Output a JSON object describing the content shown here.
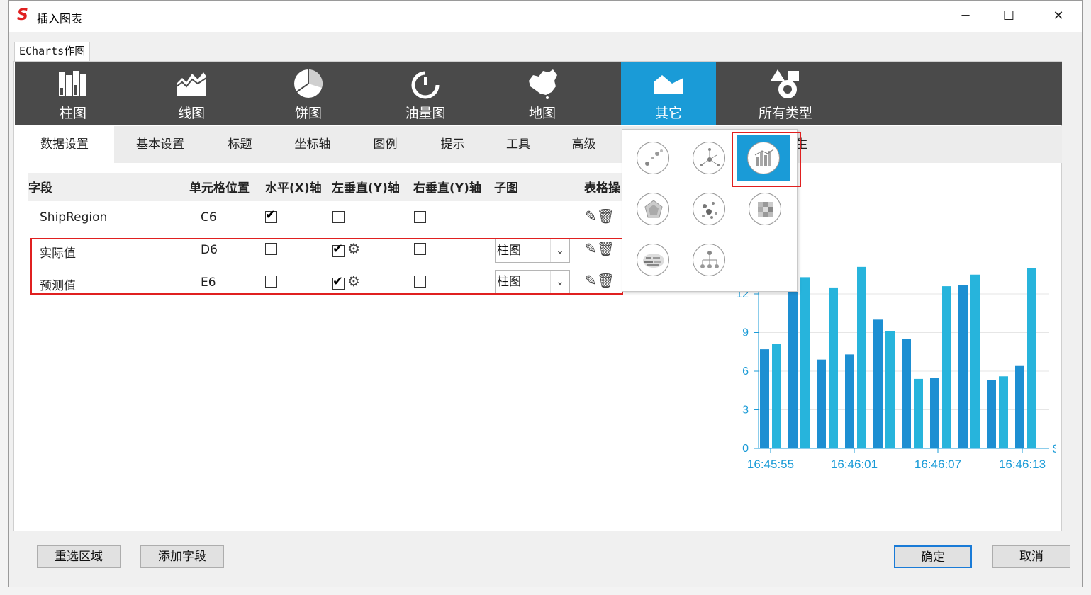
{
  "window": {
    "title": "插入图表",
    "minimize": "─",
    "maximize": "☐",
    "close": "✕",
    "logo": "S"
  },
  "editor_tab": "ECharts作图",
  "chart_types": [
    {
      "label": "柱图",
      "icon": "bar-chart-icon"
    },
    {
      "label": "线图",
      "icon": "line-chart-icon"
    },
    {
      "label": "饼图",
      "icon": "pie-chart-icon"
    },
    {
      "label": "油量图",
      "icon": "gauge-icon"
    },
    {
      "label": "地图",
      "icon": "map-icon"
    },
    {
      "label": "其它",
      "icon": "other-chart-icon",
      "active": true
    },
    {
      "label": "所有类型",
      "icon": "all-types-icon"
    }
  ],
  "sub_tabs": [
    "数据设置",
    "基本设置",
    "标题",
    "坐标轴",
    "图例",
    "提示",
    "工具",
    "高级",
    "生"
  ],
  "table": {
    "headers": [
      "字段",
      "单元格位置",
      "水平(X)轴",
      "左垂直(Y)轴",
      "右垂直(Y)轴",
      "子图",
      "表格操"
    ],
    "rows": [
      {
        "field": "ShipRegion",
        "cell": "C6",
        "x_axis": true,
        "y_left": false,
        "y_right": false,
        "subchart": ""
      },
      {
        "field": "实际值",
        "cell": "D6",
        "x_axis": false,
        "y_left": true,
        "y_right": false,
        "subchart": "柱图"
      },
      {
        "field": "预测值",
        "cell": "E6",
        "x_axis": false,
        "y_left": true,
        "y_right": false,
        "subchart": "柱图"
      }
    ]
  },
  "popup_icons": [
    "scatter-icon",
    "radial-tree-icon",
    "mixed-bar-line-icon",
    "radar-icon",
    "graph-icon",
    "heatmap-icon",
    "word-cloud-icon",
    "tree-icon"
  ],
  "chart_data": {
    "type": "bar",
    "x_tick_labels": [
      "16:45:55",
      "16:46:01",
      "16:46:07",
      "16:46:13"
    ],
    "y_tick_labels": [
      "0",
      "3",
      "6",
      "9",
      "12"
    ],
    "ylim": [
      0,
      15
    ],
    "axis_name_fragment": "Sh",
    "series": [
      {
        "color": "#1d8fd2",
        "values": [
          7.7,
          12.3,
          6.9,
          7.3,
          10.0,
          8.5,
          5.5,
          12.7,
          5.3,
          6.4
        ]
      },
      {
        "color": "#27b4dc",
        "values": [
          8.1,
          13.3,
          12.5,
          14.1,
          9.1,
          5.4,
          12.6,
          13.5,
          5.6,
          14.0
        ]
      }
    ]
  },
  "buttons": {
    "reselect": "重选区域",
    "add_field": "添加字段",
    "ok": "确定",
    "cancel": "取消"
  },
  "colors": {
    "accent": "#1a9bd7",
    "highlight": "#e02020",
    "toolbar": "#4a4a4a"
  }
}
